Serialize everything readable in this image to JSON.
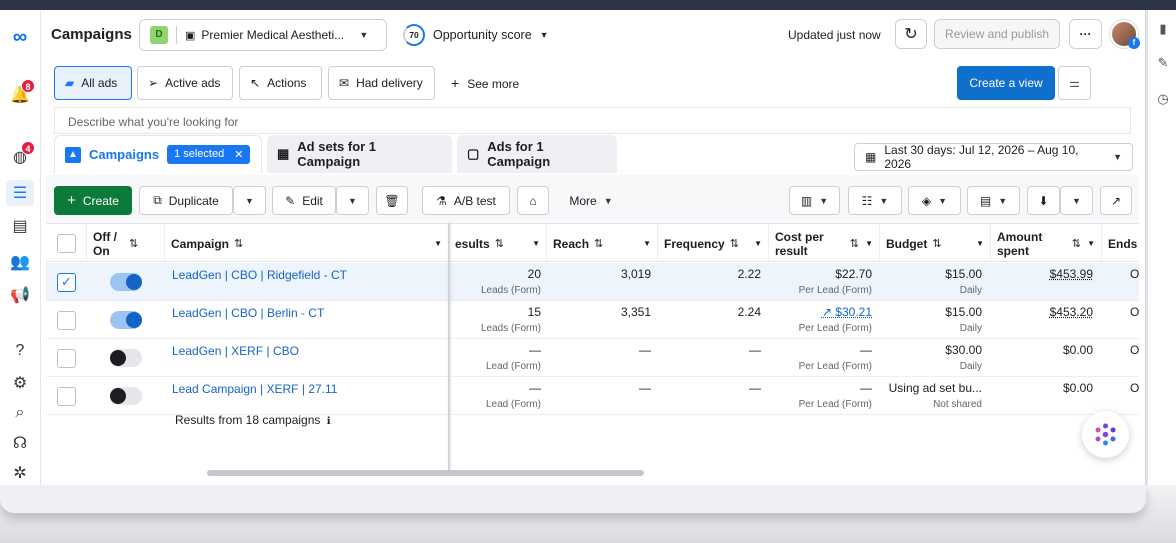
{
  "app": {
    "title": "Campaigns"
  },
  "nav": {
    "notif_badge": "8",
    "messages_badge": "4"
  },
  "header": {
    "account_initial": "D",
    "account_name": "Premier Medical Aestheti...",
    "opportunity_value": "70",
    "opportunity_label": "Opportunity score",
    "updated": "Updated just now",
    "review_publish": "Review and publish",
    "more_glyph": "···"
  },
  "filters": {
    "all_ads": "All ads",
    "active_ads": "Active ads",
    "actions": "Actions",
    "had_delivery": "Had delivery",
    "see_more": "See more",
    "create_view": "Create a view"
  },
  "search": {
    "placeholder": "Describe what you're looking for"
  },
  "levels": {
    "campaigns": "Campaigns",
    "selected": "1 selected",
    "adsets": "Ad sets for 1 Campaign",
    "ads": "Ads for 1 Campaign",
    "date_range": "Last 30 days: Jul 12, 2026 – Aug 10, 2026"
  },
  "toolbar": {
    "create": "Create",
    "duplicate": "Duplicate",
    "edit": "Edit",
    "ab_test": "A/B test",
    "more": "More"
  },
  "columns": {
    "offon_1": "Off /",
    "offon_2": "On",
    "campaign": "Campaign",
    "results": "esults",
    "reach": "Reach",
    "frequency": "Frequency",
    "cost_1": "Cost per",
    "cost_2": "result",
    "budget": "Budget",
    "spent_1": "Amount",
    "spent_2": "spent",
    "ends": "Ends"
  },
  "rows": [
    {
      "name": "LeadGen | CBO | Ridgefield - CT",
      "on": true,
      "selected": true,
      "results": "20",
      "results_sub": "Leads (Form)",
      "reach": "3,019",
      "freq": "2.22",
      "cost": "$22.70",
      "cost_sub": "Per Lead (Form)",
      "budget": "$15.00",
      "budget_sub": "Daily",
      "spent": "$453.99",
      "ends": "O"
    },
    {
      "name": "LeadGen | CBO | Berlin - CT",
      "on": true,
      "selected": false,
      "results": "15",
      "results_sub": "Leads (Form)",
      "reach": "3,351",
      "freq": "2.24",
      "cost": "$30.21",
      "cost_sub": "Per Lead (Form)",
      "budget": "$15.00",
      "budget_sub": "Daily",
      "spent": "$453.20",
      "ends": "O"
    },
    {
      "name": "LeadGen | XERF | CBO",
      "on": false,
      "selected": false,
      "results": "—",
      "results_sub": "Lead (Form)",
      "reach": "—",
      "freq": "—",
      "cost": "—",
      "cost_sub": "Per Lead (Form)",
      "budget": "$30.00",
      "budget_sub": "Daily",
      "spent": "$0.00",
      "ends": "O"
    },
    {
      "name": "Lead Campaign | XERF | 27.11",
      "on": false,
      "selected": false,
      "results": "—",
      "results_sub": "Lead (Form)",
      "reach": "—",
      "freq": "—",
      "cost": "—",
      "cost_sub": "Per Lead (Form)",
      "budget": "Using ad set bu...",
      "budget_sub": "Not shared",
      "spent": "$0.00",
      "ends": "O"
    }
  ],
  "footer": {
    "results_text": "Results from 18 campaigns"
  }
}
